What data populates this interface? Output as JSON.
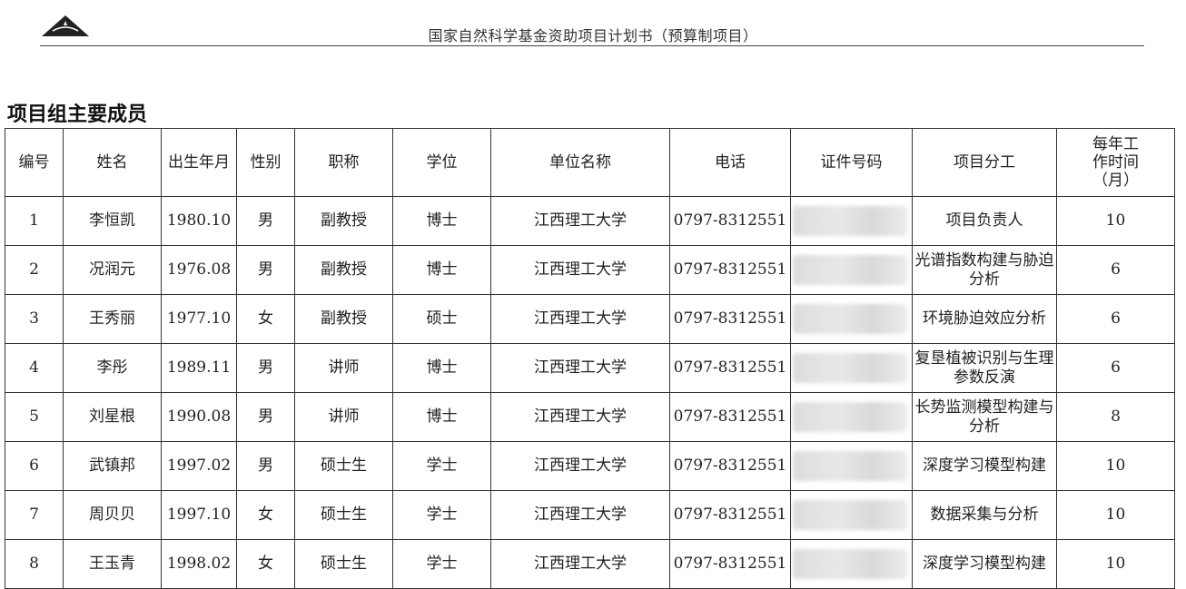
{
  "header": {
    "title": "国家自然科学基金资助项目计划书（预算制项目）"
  },
  "section": {
    "title": "项目组主要成员"
  },
  "table": {
    "headers": {
      "no": "编号",
      "name": "姓名",
      "birth": "出生年月",
      "gender": "性别",
      "title": "职称",
      "degree": "学位",
      "unit": "单位名称",
      "phone": "电话",
      "id": "证件号码",
      "duty": "项目分工",
      "months": "每年工作时间（月）"
    },
    "rows": [
      {
        "no": "1",
        "name": "李恒凯",
        "birth": "1980.10",
        "gender": "男",
        "title": "副教授",
        "degree": "博士",
        "unit": "江西理工大学",
        "phone": "0797-8312551",
        "duty": "项目负责人",
        "months": "10"
      },
      {
        "no": "2",
        "name": "况润元",
        "birth": "1976.08",
        "gender": "男",
        "title": "副教授",
        "degree": "博士",
        "unit": "江西理工大学",
        "phone": "0797-8312551",
        "duty": "光谱指数构建与胁迫分析",
        "months": "6"
      },
      {
        "no": "3",
        "name": "王秀丽",
        "birth": "1977.10",
        "gender": "女",
        "title": "副教授",
        "degree": "硕士",
        "unit": "江西理工大学",
        "phone": "0797-8312551",
        "duty": "环境胁迫效应分析",
        "months": "6"
      },
      {
        "no": "4",
        "name": "李彤",
        "birth": "1989.11",
        "gender": "男",
        "title": "讲师",
        "degree": "博士",
        "unit": "江西理工大学",
        "phone": "0797-8312551",
        "duty": "复垦植被识别与生理参数反演",
        "months": "6"
      },
      {
        "no": "5",
        "name": "刘星根",
        "birth": "1990.08",
        "gender": "男",
        "title": "讲师",
        "degree": "博士",
        "unit": "江西理工大学",
        "phone": "0797-8312551",
        "duty": "长势监测模型构建与分析",
        "months": "8"
      },
      {
        "no": "6",
        "name": "武镇邦",
        "birth": "1997.02",
        "gender": "男",
        "title": "硕士生",
        "degree": "学士",
        "unit": "江西理工大学",
        "phone": "0797-8312551",
        "duty": "深度学习模型构建",
        "months": "10"
      },
      {
        "no": "7",
        "name": "周贝贝",
        "birth": "1997.10",
        "gender": "女",
        "title": "硕士生",
        "degree": "学士",
        "unit": "江西理工大学",
        "phone": "0797-8312551",
        "duty": "数据采集与分析",
        "months": "10"
      },
      {
        "no": "8",
        "name": "王玉青",
        "birth": "1998.02",
        "gender": "女",
        "title": "硕士生",
        "degree": "学士",
        "unit": "江西理工大学",
        "phone": "0797-8312551",
        "duty": "深度学习模型构建",
        "months": "10"
      }
    ]
  }
}
